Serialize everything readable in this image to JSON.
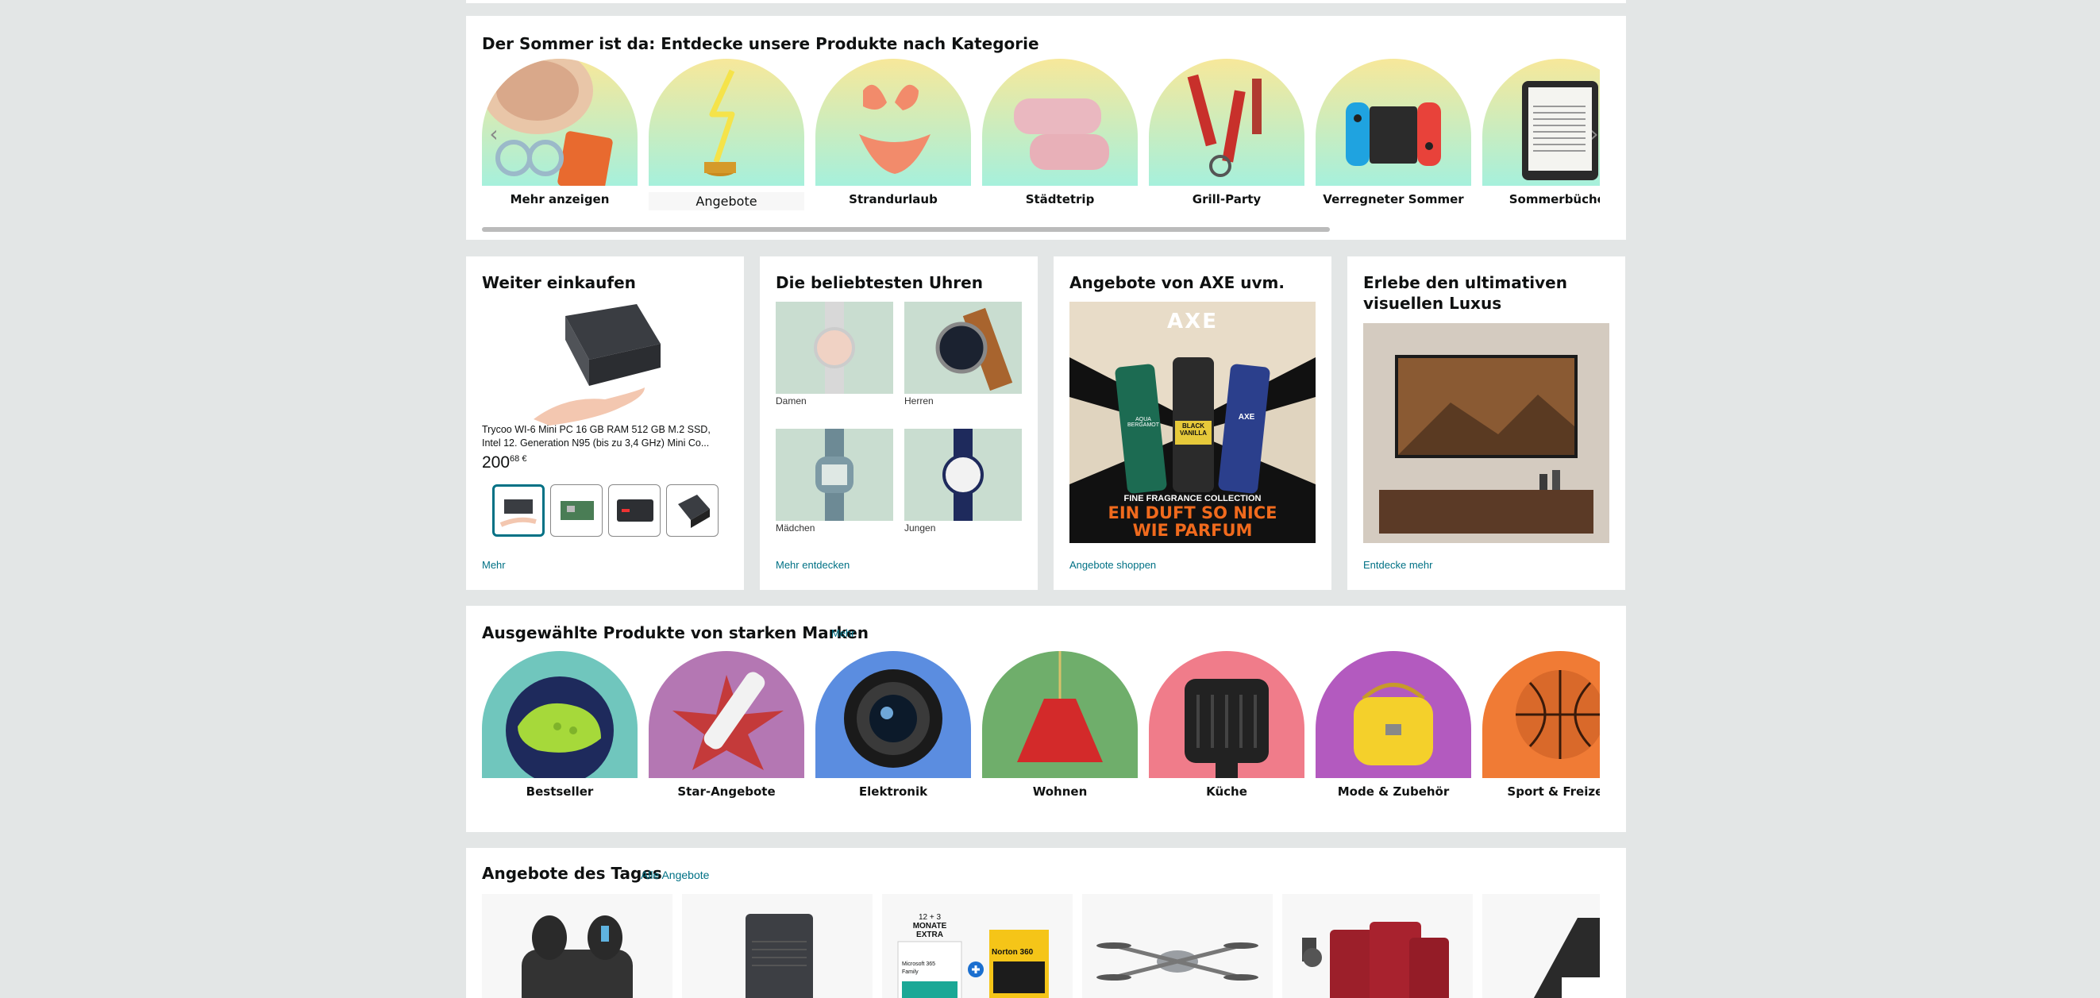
{
  "summer": {
    "title": "Der Sommer ist da: Entdecke unsere Produkte nach Kategorie",
    "items": [
      {
        "label": "Mehr anzeigen"
      },
      {
        "label": "Angebote"
      },
      {
        "label": "Strandurlaub"
      },
      {
        "label": "Städtetrip"
      },
      {
        "label": "Grill-Party"
      },
      {
        "label": "Verregneter Sommer"
      },
      {
        "label": "Sommerbücher"
      }
    ]
  },
  "continue": {
    "title": "Weiter einkaufen",
    "product_title": "Trycoo WI-6 Mini PC 16 GB RAM 512 GB M.2 SSD, Intel 12. Generation N95 (bis zu 3,4 GHz) Mini Co...",
    "price_whole": "200",
    "price_fraction": "68 €",
    "link": "Mehr"
  },
  "watches": {
    "title": "Die beliebtesten Uhren",
    "tiles": [
      {
        "label": "Damen"
      },
      {
        "label": "Herren"
      },
      {
        "label": "Mädchen"
      },
      {
        "label": "Jungen"
      }
    ],
    "link": "Mehr entdecken"
  },
  "axe": {
    "title": "Angebote von AXE uvm.",
    "brand": "AXE",
    "banner_small": "FINE FRAGRANCE COLLECTION",
    "banner_line1": "EIN DUFT SO NICE",
    "banner_line2": "WIE PARFUM",
    "can1": "AQUA BERGAMOT",
    "can2": "BLACK VANILLA",
    "can3": "AXE",
    "link": "Angebote shoppen"
  },
  "luxury": {
    "title_line1": "Erlebe den ultimativen",
    "title_line2": "visuellen Luxus",
    "link": "Entdecke mehr"
  },
  "brands": {
    "title": "Ausgewählte Produkte von starken Marken",
    "more": "Mehr",
    "items": [
      {
        "label": "Bestseller"
      },
      {
        "label": "Star-Angebote"
      },
      {
        "label": "Elektronik"
      },
      {
        "label": "Wohnen"
      },
      {
        "label": "Küche"
      },
      {
        "label": "Mode & Zubehör"
      },
      {
        "label": "Sport & Freizeit"
      }
    ]
  },
  "deals": {
    "title": "Angebote des Tages",
    "link": "Alle Angebote",
    "norton_text1": "12 + 3",
    "norton_text2": "MONATE",
    "norton_text3": "EXTRA",
    "norton_text4": "Microsoft 365",
    "norton_text5": "Family",
    "norton_brand": "Norton 360"
  },
  "colors": {
    "link": "#007185",
    "background": "#e3e6e6",
    "summer_gradient_top": "#f7e89a",
    "summer_gradient_bottom": "#a6f0dc"
  }
}
